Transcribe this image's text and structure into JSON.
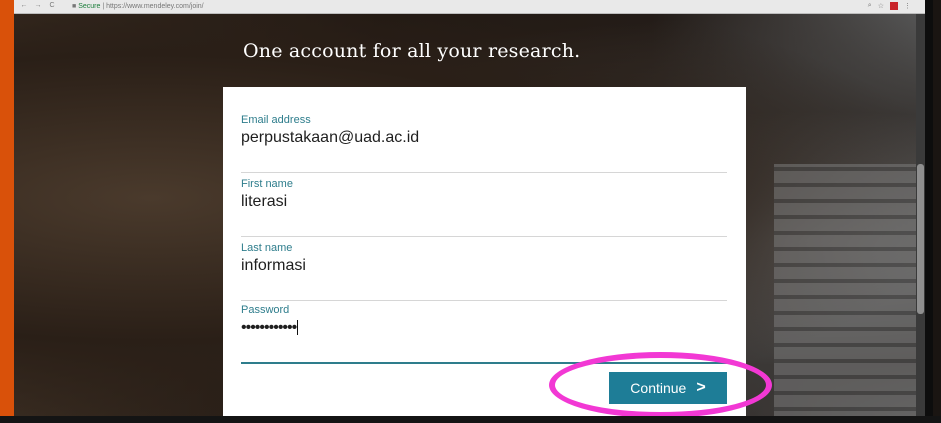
{
  "browser": {
    "address_secure": "Secure",
    "address_url": "| https://www.mendeley.com/join/",
    "ext_color": "#c9252b"
  },
  "page": {
    "headline": "One account for all your research."
  },
  "form": {
    "email": {
      "label": "Email address",
      "value": "perpustakaan@uad.ac.id"
    },
    "first_name": {
      "label": "First name",
      "value": "literasi"
    },
    "last_name": {
      "label": "Last name",
      "value": "informasi"
    },
    "password": {
      "label": "Password",
      "value_masked": "••••••••••••"
    },
    "continue_label": "Continue",
    "continue_icon": "chevron-right-icon"
  },
  "colors": {
    "accent": "#1e7d97",
    "label": "#2e7d8c",
    "highlight": "#f238d4",
    "left_strip": "#d9510a"
  }
}
